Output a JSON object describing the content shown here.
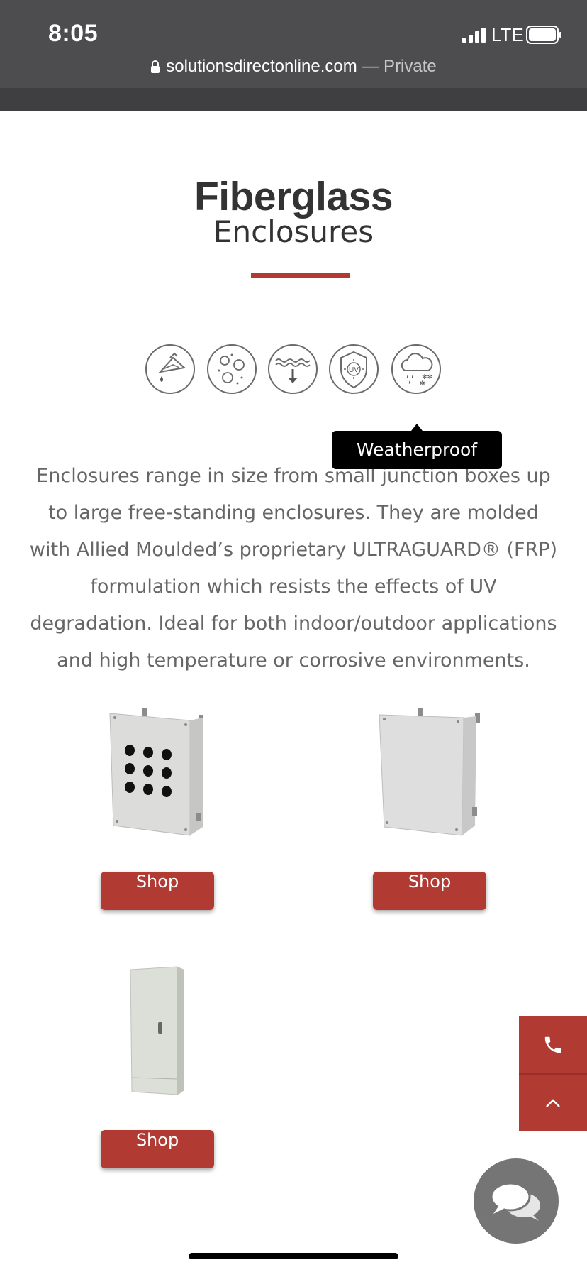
{
  "status_bar": {
    "time": "8:05",
    "network": "LTE"
  },
  "url_bar": {
    "domain": "solutionsdirectonline.com",
    "suffix": " — Private"
  },
  "heading": {
    "title": "Fiberglass",
    "subtitle": "Enclosures"
  },
  "features": {
    "icons": [
      "chemical-resistant-icon",
      "dust-resistant-icon",
      "water-submersion-icon",
      "uv-resistant-icon",
      "weatherproof-icon"
    ],
    "tooltip": "Weatherproof"
  },
  "description": "Enclosures range in size from small junction boxes up to large free-standing enclosures. They are molded with Allied Moulded’s proprietary ULTRAGUARD® (FRP) formulation which resists the effects of UV degradation. Ideal for both indoor/outdoor applications and high temperature or corrosive environments.",
  "products": [
    {
      "label": "Shop"
    },
    {
      "label": "Shop"
    },
    {
      "label": "Shop"
    }
  ],
  "floating": {
    "phone": "phone-icon",
    "top": "chevron-up-icon",
    "chat": "chat-icon"
  },
  "colors": {
    "accent": "#b13a33",
    "topbar": "#4d4d4f",
    "text": "#333333",
    "body_text": "#666666"
  }
}
